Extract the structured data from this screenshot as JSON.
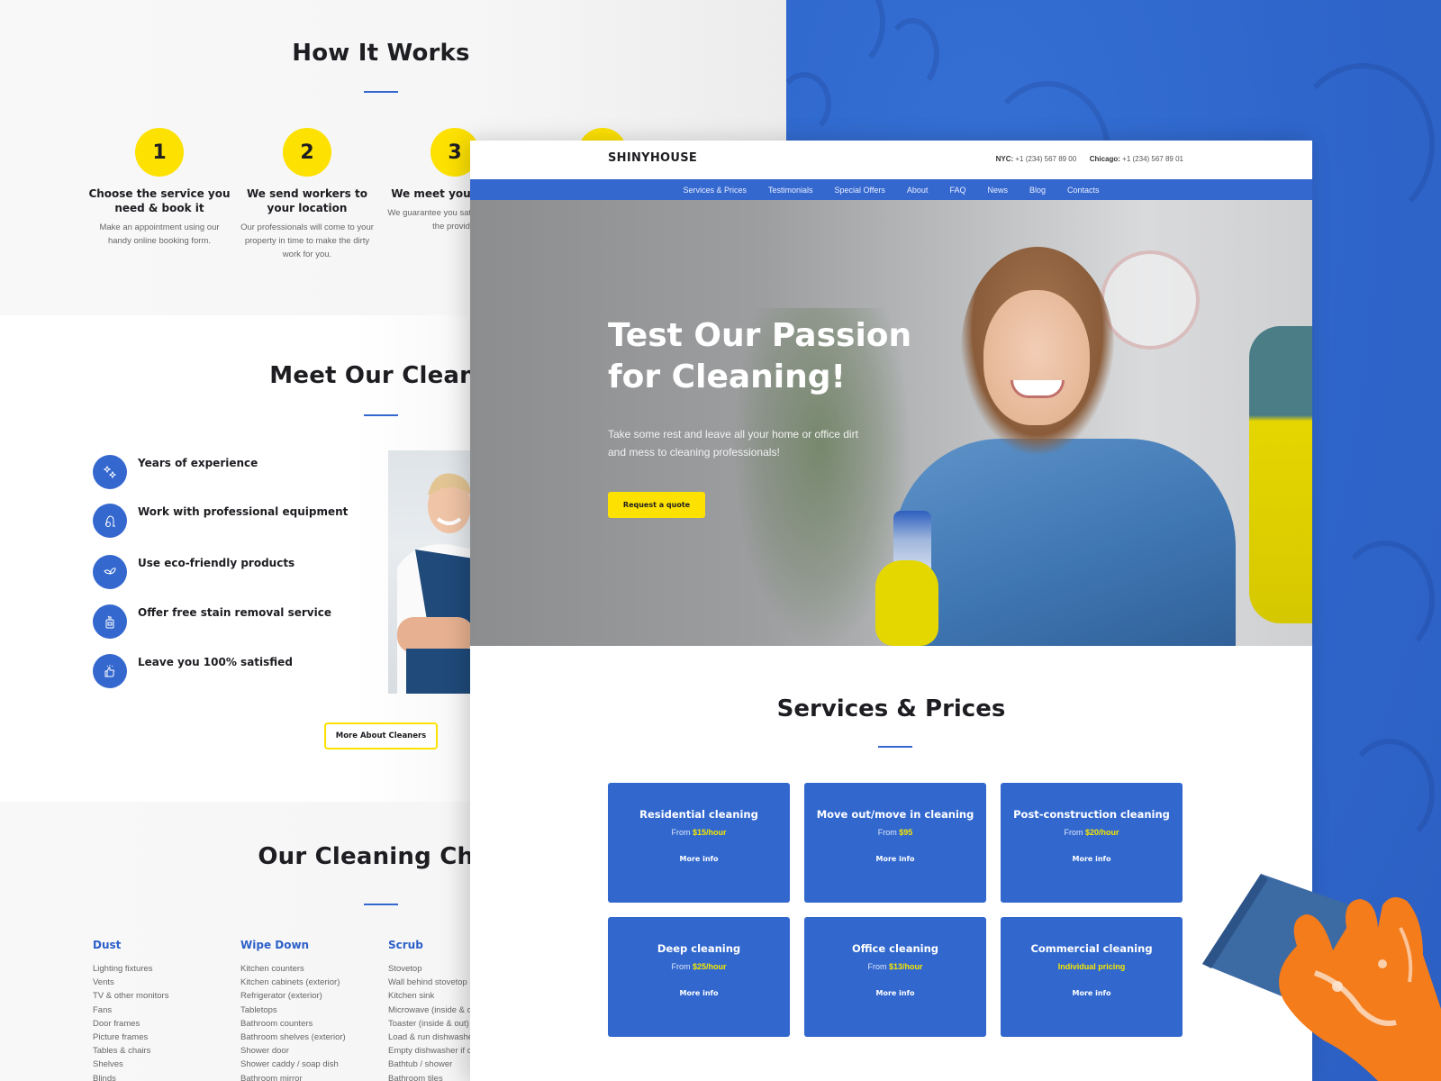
{
  "back_page": {
    "how_it_works": {
      "title": "How It Works",
      "steps": [
        {
          "number": "1",
          "title": "Choose the service you need & book it",
          "text": "Make an appointment using our handy online booking form."
        },
        {
          "number": "2",
          "title": "We send workers to your location",
          "text": "Our professionals will come to your property in time to make the dirty work for you."
        },
        {
          "number": "3",
          "title": "We meet you with ca",
          "text": "We guarantee you satisfaction from the provide."
        }
      ]
    },
    "meet_cleaners": {
      "title": "Meet Our Cleane",
      "features": [
        {
          "icon": "sparkles-icon",
          "label": "Years of experience"
        },
        {
          "icon": "vacuum-cleaner-icon",
          "label": "Work with professional equipment"
        },
        {
          "icon": "leaf-icon",
          "label": "Use eco-friendly products"
        },
        {
          "icon": "detergent-bottle-icon",
          "label": "Offer free stain removal service"
        },
        {
          "icon": "thumbs-up-icon",
          "label": "Leave you 100% satisfied"
        }
      ],
      "more_button": "More About Cleaners"
    },
    "checklist": {
      "title": "Our Cleaning Chec",
      "columns": [
        {
          "heading": "Dust",
          "items": [
            "Lighting fixtures",
            "Vents",
            "TV & other monitors",
            "Fans",
            "Door frames",
            "Picture frames",
            "Tables & chairs",
            "Shelves",
            "Blinds"
          ]
        },
        {
          "heading": "Wipe Down",
          "items": [
            "Kitchen counters",
            "Kitchen cabinets (exterior)",
            "Refrigerator (exterior)",
            "Tabletops",
            "Bathroom counters",
            "Bathroom shelves (exterior)",
            "Shower door",
            "Shower caddy / soap dish",
            "Bathroom mirror"
          ]
        },
        {
          "heading": "Scrub",
          "items": [
            "Stovetop",
            "Wall behind stovetop",
            "Kitchen sink",
            "Microwave (inside & ou",
            "Toaster (inside & out)",
            "Load & run dishwashe",
            "Empty dishwasher if c",
            "Bathtub / shower",
            "Bathroom tiles"
          ]
        }
      ]
    }
  },
  "front_page": {
    "logo": "SHINYHOUSE",
    "contacts": [
      {
        "city": "NYC:",
        "phone": "+1 (234) 567 89 00"
      },
      {
        "city": "Chicago:",
        "phone": "+1 (234) 567 89 01"
      }
    ],
    "nav": [
      "Services & Prices",
      "Testimonials",
      "Special Offers",
      "About",
      "FAQ",
      "News",
      "Blog",
      "Contacts"
    ],
    "hero": {
      "title_line1": "Test Our Passion",
      "title_line2": "for Cleaning!",
      "subtitle": "Take some rest and leave all your home or office dirt and mess to cleaning professionals!",
      "cta": "Request a quote"
    },
    "services": {
      "title": "Services & Prices",
      "cards": [
        {
          "title": "Residential cleaning",
          "price_prefix": "From ",
          "price": "$15/hour",
          "more": "More info"
        },
        {
          "title": "Move out/move in cleaning",
          "price_prefix": "From ",
          "price": "$95",
          "more": "More info"
        },
        {
          "title": "Post-construction cleaning",
          "price_prefix": "From ",
          "price": "$20/hour",
          "more": "More info"
        },
        {
          "title": "Deep cleaning",
          "price_prefix": "From ",
          "price": "$25/hour",
          "more": "More info"
        },
        {
          "title": "Office cleaning",
          "price_prefix": "From ",
          "price": "$13/hour",
          "more": "More info"
        },
        {
          "title": "Commercial cleaning",
          "price_prefix": "",
          "price": "Individual pricing",
          "more": "More info"
        }
      ]
    }
  },
  "colors": {
    "brand_blue": "#3568cf",
    "accent_yellow": "#fde100",
    "heading_dark": "#1d1d22",
    "price_yellow": "#f6e600"
  }
}
